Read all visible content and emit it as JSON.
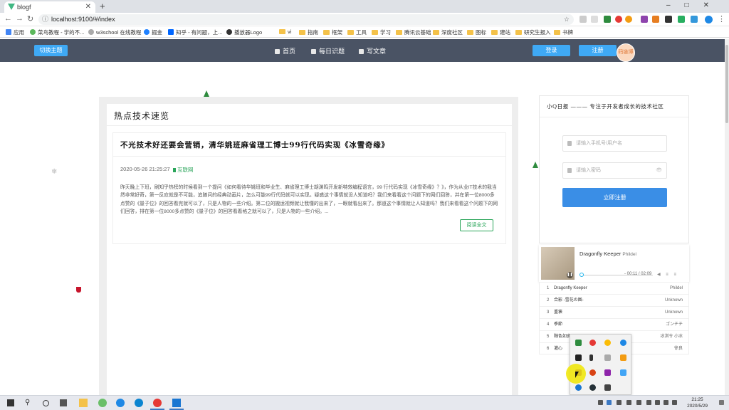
{
  "browser": {
    "tab_title": "blogf",
    "tab_close": "✕",
    "new_tab": "+",
    "window_controls": "–□✕",
    "url": "localhost:9100/#/index",
    "bookmarks": [
      "应用",
      "菜鸟教程 - 学的不...",
      "w3school 在线教程",
      "掘金",
      "知乎 - 有问题，上...",
      "播放器Logo",
      "vi",
      "指南",
      "框架",
      "工具",
      "学习",
      "腾讯云基础",
      "深度社区",
      "图标",
      "建站",
      "研究生报入",
      "书牌"
    ]
  },
  "header": {
    "theme_button": "切换主题",
    "nav": [
      "首页",
      "每日识题",
      "写文章"
    ],
    "login": "登录",
    "register": "注册",
    "avatar_text": "码链博"
  },
  "main": {
    "section_title": "热点技术速览",
    "article": {
      "title": "不光技术好还要会营销，清华姚班麻省理工博士99行代码实现《冰雪奇缘》",
      "date": "2020-05-26 21:25:27",
      "tag": "互联网",
      "body": "昨天晚上下班，刷知乎热榜的时候看到一个提问《如何看待华姚班和毕业生、麻省理工博士胡渊鸣开发新特效编程语言，99 行代码实现《冰雪奇缘》？》，作为从业IT技术的我当然非常好奇，第一反应就是不可能，追随问的经典动画片，怎么可能99行代码就可以实现。疑惑这个事情就没人知道吗？我们来看看这个问题下的网们回答，并在第一位8000多点赞的《量子位》的回答看完就可以了，只是人物的一些介绍。第二位的搬运视频就让我懂的出来了，一眼就看出来了。那道这个事情就让人知道吗？我们来看看这个问题下的网们回答，排在第一位8000多点赞的《量子位》的回答看着格之就可以了，只是人物的一些介绍。...",
      "read_more": "阅读全文"
    }
  },
  "sidebar": {
    "slogan": "小Q日报 ——— 专注于开发者成长的技术社区",
    "account_placeholder": "请输入手机号/用户名",
    "password_placeholder": "请输入密码",
    "submit": "立即注册",
    "eye": "👁"
  },
  "player": {
    "current_title": "Dragonfly Keeper",
    "current_artist": "Phildel",
    "time": "- 00:11 / 02:09",
    "playlist": [
      {
        "n": "1",
        "title": "Dragonfly Keeper",
        "artist": "Phildel"
      },
      {
        "n": "2",
        "title": "合影 -雪花の图-",
        "artist": "Unknown"
      },
      {
        "n": "3",
        "title": "重褒",
        "artist": "Unknown"
      },
      {
        "n": "4",
        "title": "季節",
        "artist": "ゴンチチ"
      },
      {
        "n": "5",
        "title": "釉色如瓷",
        "artist": "冰淇令 小冰"
      },
      {
        "n": "6",
        "title": "灌心",
        "artist": "徐良"
      }
    ]
  },
  "taskbar": {
    "time": "21:25",
    "date": "2020/5/29"
  },
  "colors": {
    "nav_bg": "#4a5364",
    "accent_blue": "#3fa9f5",
    "tag_green": "#2aa55a"
  }
}
